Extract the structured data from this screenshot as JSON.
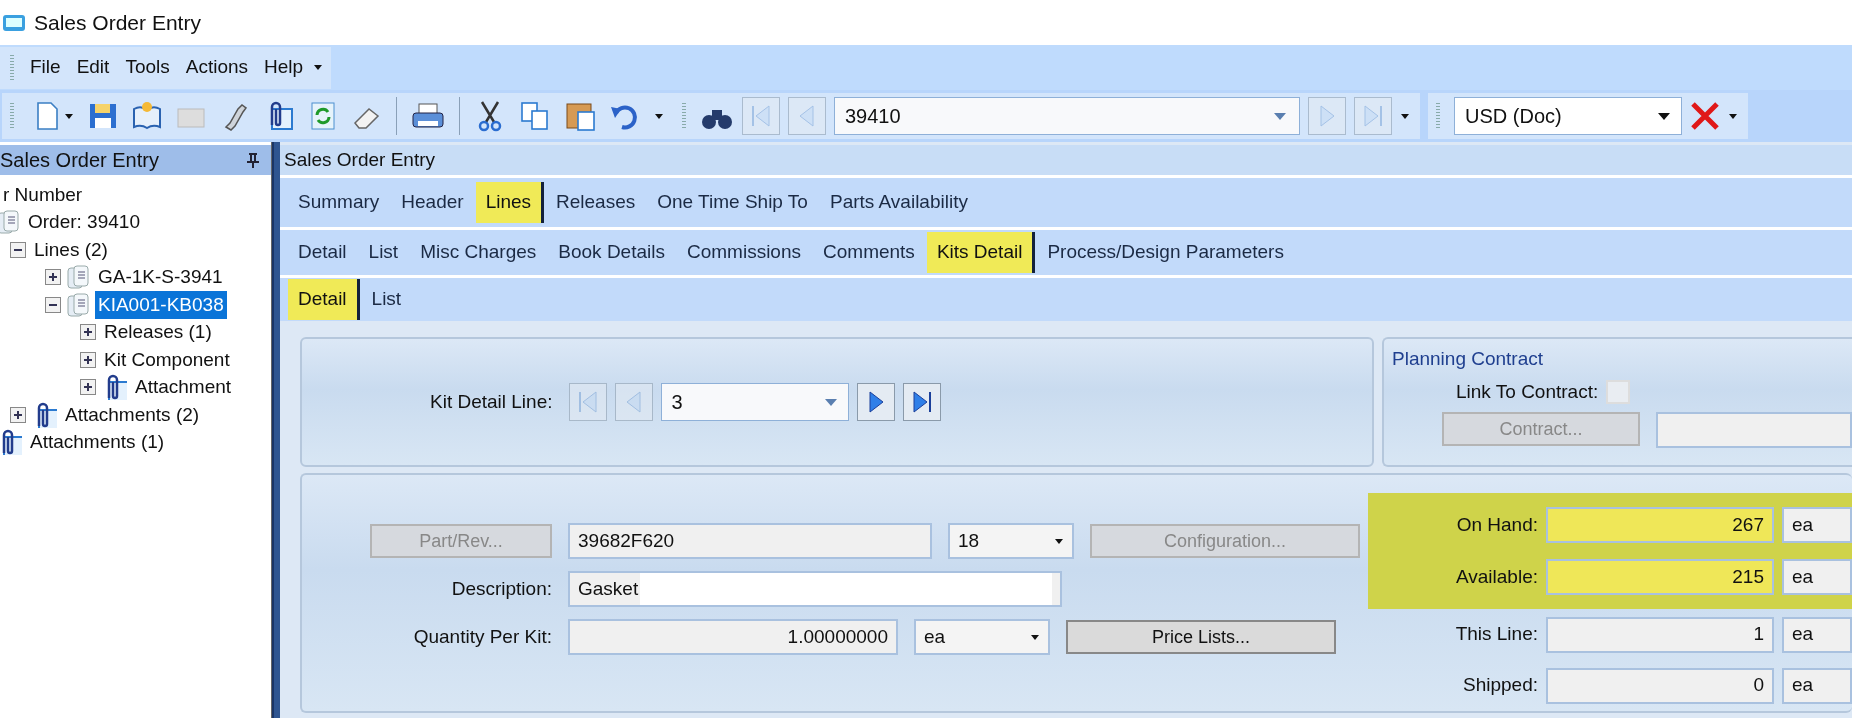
{
  "window": {
    "title": "Sales Order Entry"
  },
  "menu": [
    {
      "label": "File"
    },
    {
      "label": "Edit"
    },
    {
      "label": "Tools"
    },
    {
      "label": "Actions"
    },
    {
      "label": "Help"
    }
  ],
  "toolbar": {
    "record": "39410",
    "record_nav": [
      {
        "disabled": true
      },
      {
        "disabled": true
      },
      {
        "disabled": true
      },
      {
        "disabled": true
      }
    ],
    "currency": "USD (Doc)"
  },
  "tree_panel": {
    "title": "Sales Order Entry",
    "items": [
      {
        "label": "r Number",
        "kind": "label",
        "children": [
          {
            "label": "Order: 39410",
            "kind": "order",
            "children": [
              {
                "label": "Lines (2)",
                "kind": "folder",
                "expanded": true,
                "children": [
                  {
                    "label": "GA-1K-S-3941",
                    "kind": "line",
                    "expanded": false,
                    "selected": false
                  },
                  {
                    "label": "KIA001-KB038",
                    "kind": "line",
                    "expanded": true,
                    "selected": true,
                    "children": [
                      {
                        "label": "Releases (1)",
                        "kind": "folder",
                        "expanded": false
                      },
                      {
                        "label": "Kit Component",
                        "kind": "folder",
                        "expanded": false
                      },
                      {
                        "label": "Attachment",
                        "kind": "attachment",
                        "expanded": false
                      }
                    ]
                  }
                ]
              },
              {
                "label": "Attachments (2)",
                "kind": "attachment",
                "expanded": false
              }
            ]
          },
          {
            "label": "Attachments (1)",
            "kind": "attachment"
          }
        ]
      }
    ]
  },
  "form_title": "Sales Order Entry",
  "tabs": [
    {
      "label": "Summary",
      "selected": false
    },
    {
      "label": "Header",
      "selected": false
    },
    {
      "label": "Lines",
      "selected": true
    },
    {
      "label": "Releases",
      "selected": false
    },
    {
      "label": "One Time Ship To",
      "selected": false
    },
    {
      "label": "Parts Availability",
      "selected": false
    }
  ],
  "line_tabs": [
    {
      "label": "Detail",
      "selected": false
    },
    {
      "label": "List",
      "selected": false
    },
    {
      "label": "Misc Charges",
      "selected": false
    },
    {
      "label": "Book Details",
      "selected": false
    },
    {
      "label": "Commissions",
      "selected": false
    },
    {
      "label": "Comments",
      "selected": false
    },
    {
      "label": "Kits Detail",
      "selected": true
    },
    {
      "label": "Process/Design Parameters",
      "selected": false
    }
  ],
  "kit_tabs": [
    {
      "label": "Detail",
      "selected": true
    },
    {
      "label": "List",
      "selected": false
    }
  ],
  "kit_detail_line": {
    "label": "Kit Detail Line:",
    "value": "3",
    "nav": [
      {
        "disabled": true
      },
      {
        "disabled": true
      },
      {
        "disabled": false
      },
      {
        "disabled": false
      }
    ]
  },
  "planning_contract": {
    "title": "Planning Contract",
    "link_label": "Link To Contract:",
    "checked": false,
    "contract_button": "Contract...",
    "contract_disabled": true
  },
  "part": {
    "button": "Part/Rev...",
    "button_disabled": true,
    "part_number": "39682F620",
    "revision": "18",
    "config_button": "Configuration...",
    "config_disabled": true
  },
  "description": {
    "label": "Description:",
    "value": "Gasket"
  },
  "quantity": {
    "label": "Quantity Per Kit:",
    "value": "1.00000000",
    "uom": "ea",
    "price_button": "Price Lists...",
    "price_disabled": false
  },
  "quantities": [
    {
      "label": "On Hand:",
      "value": "267",
      "uom": "ea",
      "highlighted": true
    },
    {
      "label": "Available:",
      "value": "215",
      "uom": "ea",
      "highlighted": true
    },
    {
      "label": "This Line:",
      "value": "1",
      "uom": "ea",
      "highlighted": false
    },
    {
      "label": "Shipped:",
      "value": "0",
      "uom": "ea",
      "highlighted": false
    }
  ]
}
